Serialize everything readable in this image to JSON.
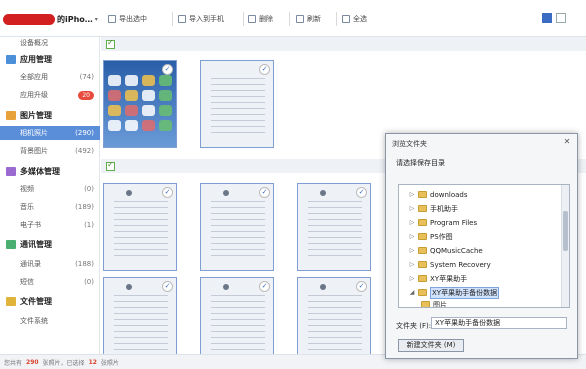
{
  "device": {
    "name": "的iPho…"
  },
  "toolbar": {
    "export": "导出选中",
    "import": "导入到手机",
    "delete": "删除",
    "refresh": "刷新",
    "select_all": "全选"
  },
  "sidebar": {
    "device_overview": "设备概况",
    "apps": {
      "title": "应用管理",
      "all": "全部应用",
      "all_count": "(74)",
      "updates": "应用升级",
      "updates_badge": "20"
    },
    "photos": {
      "title": "图片管理",
      "camera": "相机照片",
      "camera_count": "(290)",
      "wallpaper": "背景图片",
      "wallpaper_count": "(492)"
    },
    "media": {
      "title": "多媒体管理",
      "video": "视频",
      "video_count": "(0)",
      "music": "音乐",
      "music_count": "(189)",
      "ebook": "电子书",
      "ebook_count": "(1)"
    },
    "comm": {
      "title": "通讯管理",
      "contacts": "通讯录",
      "contacts_count": "(188)",
      "sms": "短信",
      "sms_count": "(0)"
    },
    "files": {
      "title": "文件管理",
      "filesystem": "文件系统"
    }
  },
  "status": {
    "prefix": "您共有",
    "total": "290",
    "mid": "张照片，已选择",
    "selected": "12",
    "suffix": "张照片"
  },
  "dialog": {
    "title": "浏览文件夹",
    "close": "✕",
    "prompt": "请选择保存目录",
    "tree": [
      "downloads",
      "手机助手",
      "Program Files",
      "PS作图",
      "QQMusicCache",
      "System Recovery",
      "XY苹果助手",
      "XY苹果助手备份数据",
      "图片"
    ],
    "folder_label": "文件夹 (F):",
    "folder_value": "XY苹果助手备份数据",
    "new_folder": "新建文件夹 (M)"
  },
  "colors": {
    "accent": "#5b8ed8",
    "badge": "#e84b3c"
  }
}
